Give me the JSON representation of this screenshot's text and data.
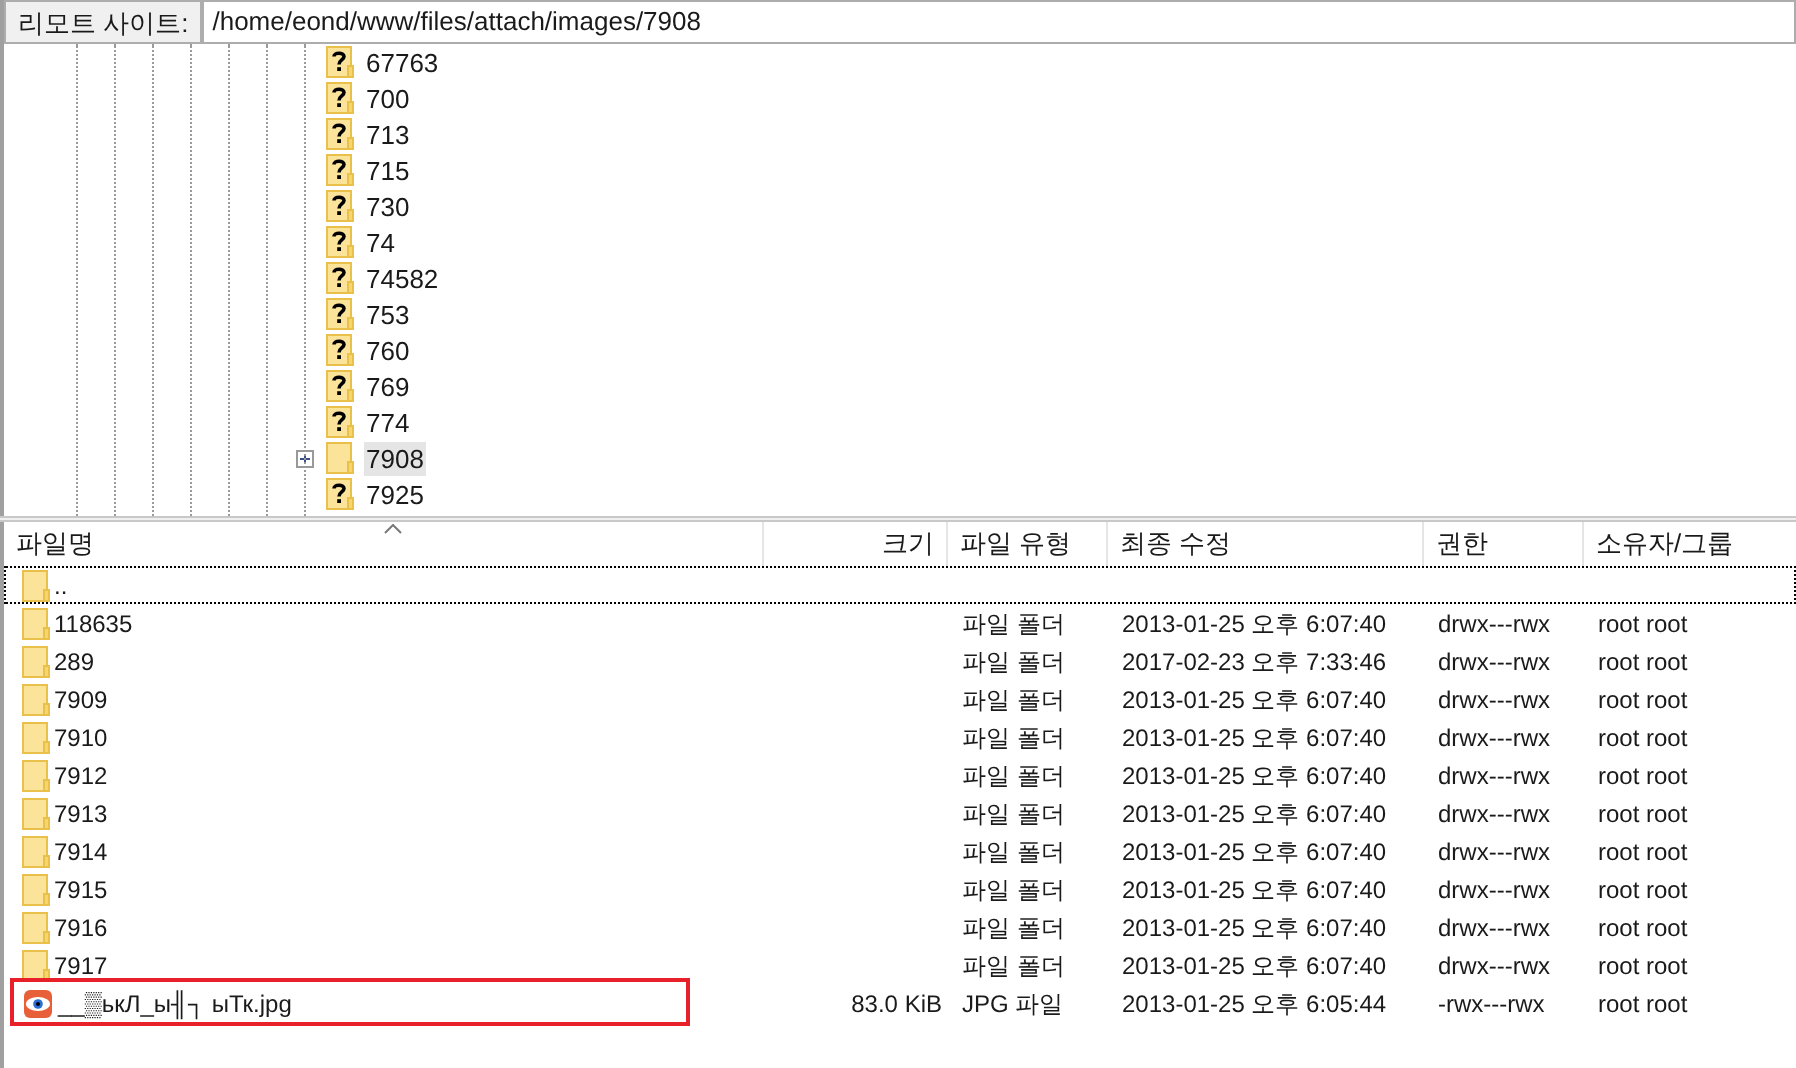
{
  "address_bar": {
    "label": "리모트 사이트:",
    "value": "/home/eond/www/files/attach/images/7908"
  },
  "tree": {
    "items": [
      {
        "name": "67763",
        "kind": "unknown",
        "expandable": false,
        "selected": false
      },
      {
        "name": "700",
        "kind": "unknown",
        "expandable": false,
        "selected": false
      },
      {
        "name": "713",
        "kind": "unknown",
        "expandable": false,
        "selected": false
      },
      {
        "name": "715",
        "kind": "unknown",
        "expandable": false,
        "selected": false
      },
      {
        "name": "730",
        "kind": "unknown",
        "expandable": false,
        "selected": false
      },
      {
        "name": "74",
        "kind": "unknown",
        "expandable": false,
        "selected": false
      },
      {
        "name": "74582",
        "kind": "unknown",
        "expandable": false,
        "selected": false
      },
      {
        "name": "753",
        "kind": "unknown",
        "expandable": false,
        "selected": false
      },
      {
        "name": "760",
        "kind": "unknown",
        "expandable": false,
        "selected": false
      },
      {
        "name": "769",
        "kind": "unknown",
        "expandable": false,
        "selected": false
      },
      {
        "name": "774",
        "kind": "unknown",
        "expandable": false,
        "selected": false
      },
      {
        "name": "7908",
        "kind": "folder",
        "expandable": true,
        "selected": true
      },
      {
        "name": "7925",
        "kind": "unknown",
        "expandable": false,
        "selected": false
      }
    ]
  },
  "table": {
    "columns": [
      "파일명",
      "크기",
      "파일 유형",
      "최종 수정",
      "권한",
      "소유자/그룹"
    ],
    "rows": [
      {
        "kind": "folder",
        "name": "..",
        "size": "",
        "type": "",
        "modified": "",
        "permissions": "",
        "owner": "",
        "focused": true,
        "highlighted": false
      },
      {
        "kind": "folder",
        "name": "118635",
        "size": "",
        "type": "파일 폴더",
        "modified": "2013-01-25 오후 6:07:40",
        "permissions": "drwx---rwx",
        "owner": "root root",
        "focused": false,
        "highlighted": false
      },
      {
        "kind": "folder",
        "name": "289",
        "size": "",
        "type": "파일 폴더",
        "modified": "2017-02-23 오후 7:33:46",
        "permissions": "drwx---rwx",
        "owner": "root root",
        "focused": false,
        "highlighted": false
      },
      {
        "kind": "folder",
        "name": "7909",
        "size": "",
        "type": "파일 폴더",
        "modified": "2013-01-25 오후 6:07:40",
        "permissions": "drwx---rwx",
        "owner": "root root",
        "focused": false,
        "highlighted": false
      },
      {
        "kind": "folder",
        "name": "7910",
        "size": "",
        "type": "파일 폴더",
        "modified": "2013-01-25 오후 6:07:40",
        "permissions": "drwx---rwx",
        "owner": "root root",
        "focused": false,
        "highlighted": false
      },
      {
        "kind": "folder",
        "name": "7912",
        "size": "",
        "type": "파일 폴더",
        "modified": "2013-01-25 오후 6:07:40",
        "permissions": "drwx---rwx",
        "owner": "root root",
        "focused": false,
        "highlighted": false
      },
      {
        "kind": "folder",
        "name": "7913",
        "size": "",
        "type": "파일 폴더",
        "modified": "2013-01-25 오후 6:07:40",
        "permissions": "drwx---rwx",
        "owner": "root root",
        "focused": false,
        "highlighted": false
      },
      {
        "kind": "folder",
        "name": "7914",
        "size": "",
        "type": "파일 폴더",
        "modified": "2013-01-25 오후 6:07:40",
        "permissions": "drwx---rwx",
        "owner": "root root",
        "focused": false,
        "highlighted": false
      },
      {
        "kind": "folder",
        "name": "7915",
        "size": "",
        "type": "파일 폴더",
        "modified": "2013-01-25 오후 6:07:40",
        "permissions": "drwx---rwx",
        "owner": "root root",
        "focused": false,
        "highlighted": false
      },
      {
        "kind": "folder",
        "name": "7916",
        "size": "",
        "type": "파일 폴더",
        "modified": "2013-01-25 오후 6:07:40",
        "permissions": "drwx---rwx",
        "owner": "root root",
        "focused": false,
        "highlighted": false
      },
      {
        "kind": "folder",
        "name": "7917",
        "size": "",
        "type": "파일 폴더",
        "modified": "2013-01-25 오후 6:07:40",
        "permissions": "drwx---rwx",
        "owner": "root root",
        "focused": false,
        "highlighted": false
      },
      {
        "kind": "image",
        "name": "__▒ькЛ_ы╢┐ ыТк.jpg",
        "size": "83.0 KiB",
        "type": "JPG 파일",
        "modified": "2013-01-25 오후 6:05:44",
        "permissions": "-rwx---rwx",
        "owner": "root root",
        "focused": false,
        "highlighted": true
      }
    ]
  }
}
